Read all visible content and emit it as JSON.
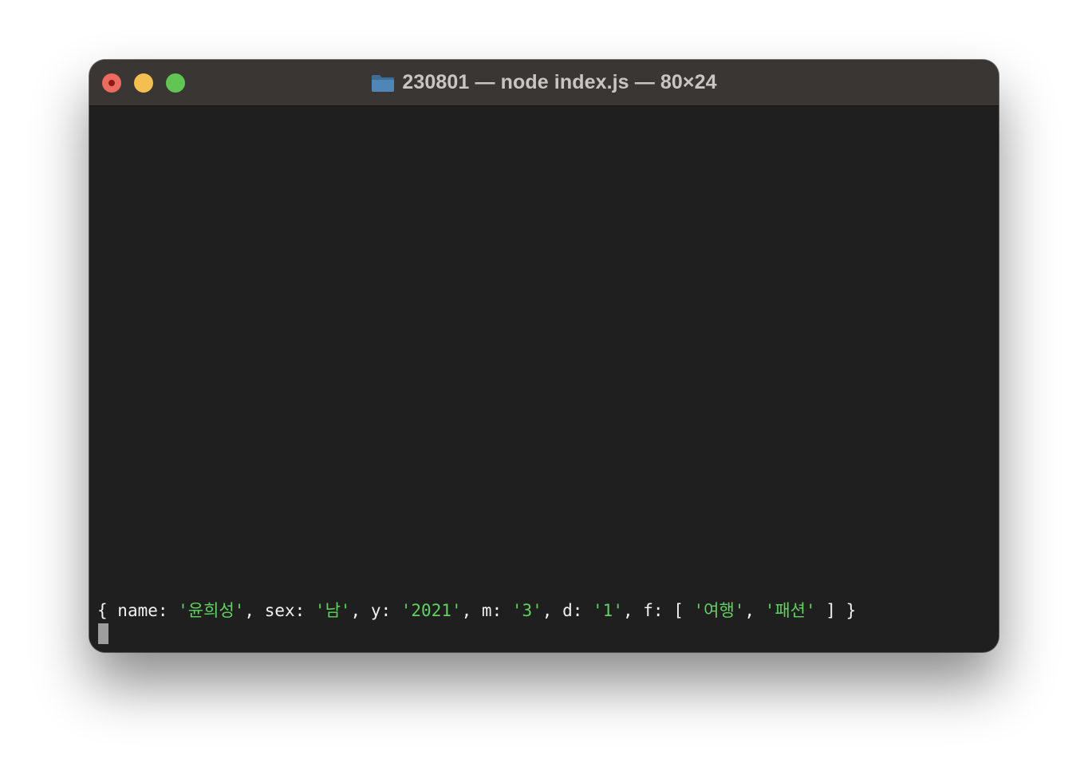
{
  "window": {
    "title": "230801 — node index.js — 80×24",
    "folder_icon": "folder-icon"
  },
  "colors": {
    "titlebar": "#3a3634",
    "terminal_bg": "#1f1f1f",
    "text": "#f2f2f2",
    "string": "#5fd35f",
    "close": "#ed6a5e",
    "minimize": "#f5bf4f",
    "zoom": "#61c554"
  },
  "terminal": {
    "line": {
      "open_brace": "{ ",
      "k_name": "name: ",
      "v_name": "'윤희성'",
      "sep1": ", ",
      "k_sex": "sex: ",
      "v_sex": "'남'",
      "sep2": ", ",
      "k_y": "y: ",
      "v_y": "'2021'",
      "sep3": ", ",
      "k_m": "m: ",
      "v_m": "'3'",
      "sep4": ", ",
      "k_d": "d: ",
      "v_d": "'1'",
      "sep5": ", ",
      "k_f": "f: [ ",
      "v_f1": "'여행'",
      "sep6": ", ",
      "v_f2": "'패션'",
      "close_all": " ] }"
    }
  }
}
